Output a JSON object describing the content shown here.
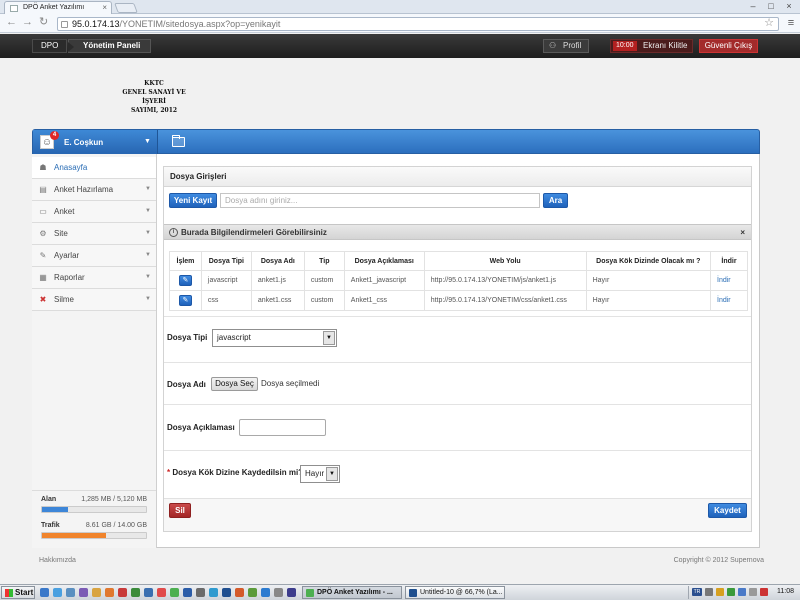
{
  "browser": {
    "tab_title": "DPÖ Anket Yazılımı",
    "url_host": "95.0.174.13",
    "url_path": "/YONETIM/sitedosya.aspx?op=yenikayit"
  },
  "topbar": {
    "brand": "DPO",
    "breadcrumb": "Yönetim Paneli",
    "profile_label": "Profil",
    "lock_time": "10:00",
    "lock_label": "Ekranı Kilitle",
    "logout_label": "Güvenli Çıkış"
  },
  "logo": {
    "line1": "KKTC",
    "line2": "GENEL SANAYİ VE İŞYERİ",
    "line3": "SAYIMI, 2012"
  },
  "user": {
    "name": "E. Coşkun",
    "badge": "4"
  },
  "sidebar": {
    "items": [
      {
        "label": "Anasayfa",
        "icon": "home-icon",
        "active": true
      },
      {
        "label": "Anket Hazırlama",
        "icon": "survey-edit-icon"
      },
      {
        "label": "Anket",
        "icon": "form-icon"
      },
      {
        "label": "Site",
        "icon": "settings-icon"
      },
      {
        "label": "Ayarlar",
        "icon": "tools-icon"
      },
      {
        "label": "Raporlar",
        "icon": "report-icon"
      },
      {
        "label": "Silme",
        "icon": "delete-icon"
      }
    ],
    "usage": {
      "space_label": "Alan",
      "space_value": "1,285 MB / 5,120 MB",
      "space_fraction": 0.25,
      "traffic_label": "Trafik",
      "traffic_value": "8.61 GB / 14.00 GB",
      "traffic_fraction": 0.615
    }
  },
  "panel": {
    "title": "Dosya Girişleri",
    "new_button": "Yeni Kayıt",
    "search_placeholder": "Dosya adını giriniz...",
    "search_button": "Ara",
    "info_text": "Burada Bilgilendirmeleri Görebilirsiniz",
    "info_close": "×",
    "table": {
      "headers": [
        "İşlem",
        "Dosya Tipi",
        "Dosya Adı",
        "Tip",
        "Dosya Açıklaması",
        "Web Yolu",
        "Dosya Kök Dizinde Olacak mı ?",
        "İndir"
      ],
      "rows": [
        {
          "type": "javascript",
          "name": "anket1.js",
          "kind": "custom",
          "desc": "Anket1_javascript",
          "path": "http://95.0.174.13/YONETIM/js/anket1.js",
          "root": "Hayır",
          "download": "İndir"
        },
        {
          "type": "css",
          "name": "anket1.css",
          "kind": "custom",
          "desc": "Anket1_css",
          "path": "http://95.0.174.13/YONETIM/css/anket1.css",
          "root": "Hayır",
          "download": "İndir"
        }
      ]
    },
    "form": {
      "type_label": "Dosya Tipi",
      "type_value": "javascript",
      "name_label": "Dosya Adı",
      "choose_button": "Dosya Seç",
      "no_file_text": "Dosya seçilmedi",
      "desc_label": "Dosya Açıklaması",
      "root_label": "Dosya Kök Dizine Kaydedilsin mi?",
      "root_required_mark": "*",
      "root_value": "Hayır"
    },
    "delete_button": "Sil",
    "save_button": "Kaydet"
  },
  "footer": {
    "left": "Hakkımızda",
    "right": "Copyright © 2012 Supernova"
  },
  "taskbar": {
    "start": "Start",
    "tasks": [
      "DPÖ Anket Yazılımı - ...",
      "Untitled-10 @ 66,7% (La..."
    ],
    "clock": "11:08",
    "tray_lang": "TR"
  }
}
